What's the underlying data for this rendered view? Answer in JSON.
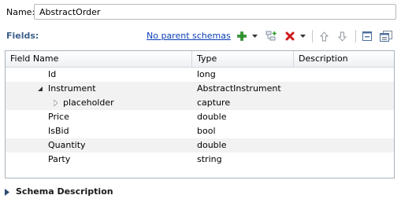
{
  "name_field": {
    "label": "Name:",
    "value": "AbstractOrder"
  },
  "fields_section": {
    "label": "Fields:",
    "parent_link": "No parent schemas",
    "toolbar": {
      "add_icon": "add-icon",
      "add_menu_icon": "dropdown-arrow-icon",
      "add_child_icon": "add-child-icon",
      "delete_icon": "delete-icon",
      "delete_menu_icon": "dropdown-arrow-icon",
      "move_up_icon": "arrow-up-icon",
      "move_down_icon": "arrow-down-icon",
      "collapse_all_icon": "collapse-all-icon",
      "expand_all_icon": "expand-all-icon"
    }
  },
  "table": {
    "columns": [
      "Field Name",
      "Type",
      "Description"
    ],
    "rows": [
      {
        "name": "Id",
        "type": "long",
        "description": "",
        "level": 0,
        "twisty": "none"
      },
      {
        "name": "Instrument",
        "type": "AbstractInstrument",
        "description": "",
        "level": 0,
        "twisty": "expanded"
      },
      {
        "name": "placeholder",
        "type": "capture",
        "description": "",
        "level": 1,
        "twisty": "collapsed"
      },
      {
        "name": "Price",
        "type": "double",
        "description": "",
        "level": 0,
        "twisty": "none"
      },
      {
        "name": "IsBid",
        "type": "bool",
        "description": "",
        "level": 0,
        "twisty": "none"
      },
      {
        "name": "Quantity",
        "type": "double",
        "description": "",
        "level": 0,
        "twisty": "none"
      },
      {
        "name": "Party",
        "type": "string",
        "description": "",
        "level": 0,
        "twisty": "none"
      }
    ]
  },
  "schema_description": {
    "label": "Schema Description",
    "state": "collapsed"
  },
  "colors": {
    "fields_label": "#3b5f8a",
    "link": "#0b3eb5",
    "add_green": "#2f9e2f",
    "delete_red": "#d11a1a",
    "alt_row": "#f2f2f2"
  }
}
